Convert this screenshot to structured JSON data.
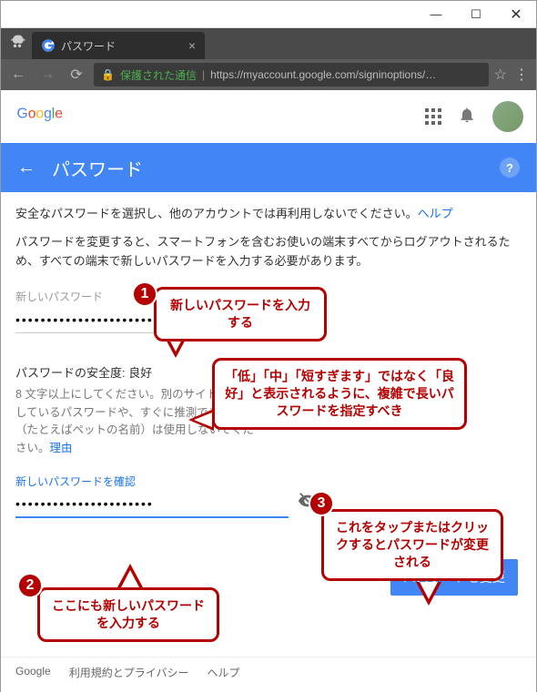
{
  "window": {
    "min": "—",
    "max": "☐",
    "close": "✕"
  },
  "tab": {
    "title": "パスワード",
    "close": "×"
  },
  "toolbar": {
    "secure": "保護された通信",
    "url": "https://myaccount.google.com/signinoptions/…",
    "star": "☆",
    "menu": "⋮"
  },
  "header": {
    "logo_alt": "Google"
  },
  "banner": {
    "back": "←",
    "title": "パスワード",
    "help": "?"
  },
  "body": {
    "intro": "安全なパスワードを選択し、他のアカウントでは再利用しないでください。",
    "help_link": "ヘルプ",
    "warning": "パスワードを変更すると、スマートフォンを含むお使いの端末すべてからログアウトされるため、すべての端末で新しいパスワードを入力する必要があります。",
    "new_label": "新しいパスワード",
    "new_value": "••••••••••••••••••••••",
    "strength_label": "パスワードの安全度: ",
    "strength_value": "良好",
    "hint": "8 文字以上にしてください。別のサイトで使用しているパスワードや、すぐに推測できる単語（たとえばペットの名前）は使用しないでください。",
    "reason_link": "理由",
    "confirm_label": "新しいパスワードを確認",
    "confirm_value": "••••••••••••••••••••••",
    "submit": "パスワードを変更"
  },
  "footer": {
    "google": "Google",
    "privacy": "利用規約とプライバシー",
    "help": "ヘルプ"
  },
  "annotations": {
    "n1": "1",
    "c1": "新しいパスワードを入力する",
    "c2": "「低」「中」「短すぎます」ではなく「良好」と表示されるように、複雑で長いパスワードを指定すべき",
    "n2": "2",
    "c3": "ここにも新しいパスワードを入力する",
    "n3": "3",
    "c4": "これをタップまたはクリックするとパスワードが変更される"
  }
}
